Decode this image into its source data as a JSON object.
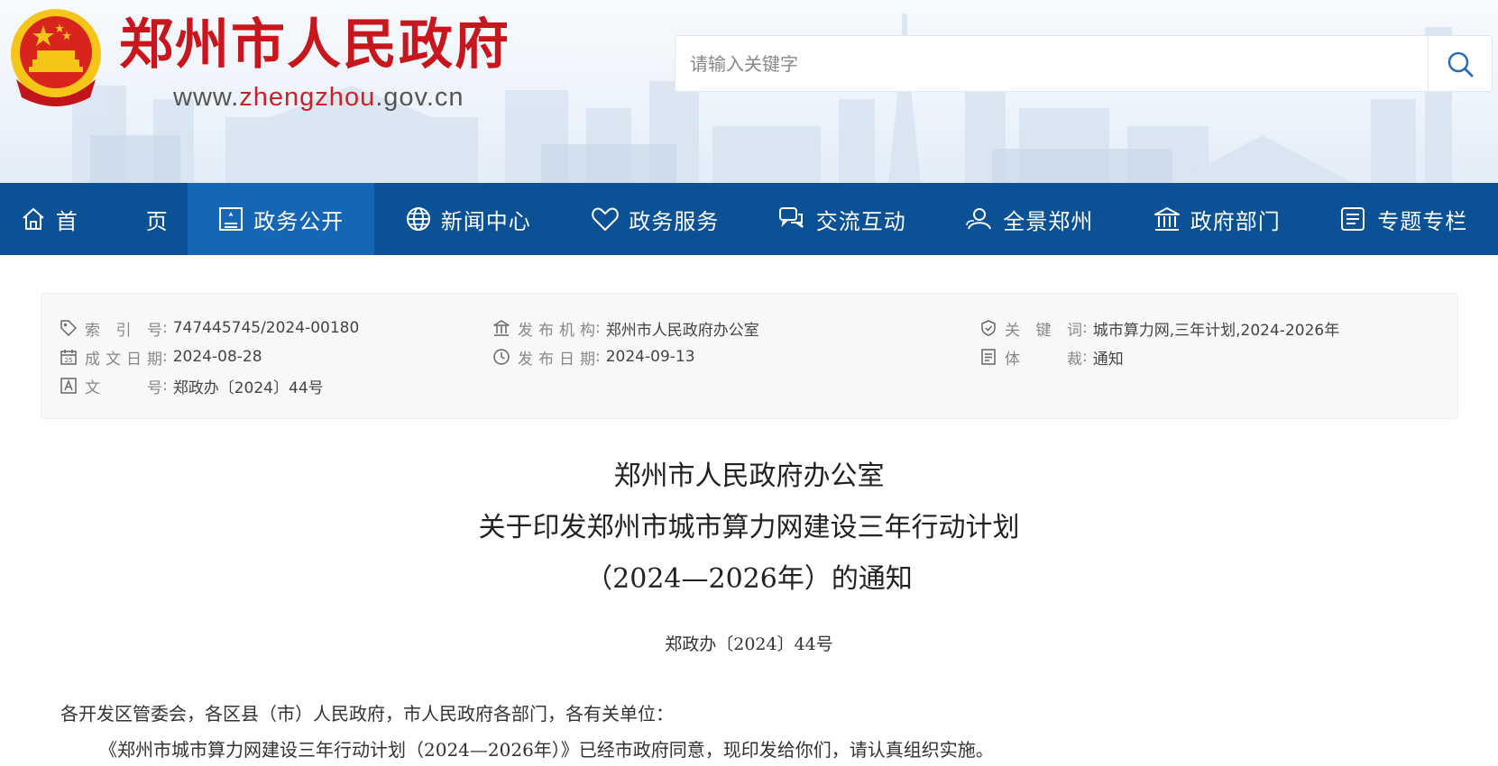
{
  "header": {
    "site_title": "郑州市人民政府",
    "url_prefix": "www.",
    "url_highlight": "zhengzhou",
    "url_suffix": ".gov.cn",
    "search": {
      "placeholder": "请输入关键字",
      "icon": "search-icon"
    }
  },
  "nav": {
    "items": [
      {
        "label": "首　页",
        "icon": "home-icon"
      },
      {
        "label": "政务公开",
        "icon": "document-icon",
        "active": true
      },
      {
        "label": "新闻中心",
        "icon": "globe-icon"
      },
      {
        "label": "政务服务",
        "icon": "heart-icon"
      },
      {
        "label": "交流互动",
        "icon": "chat-icon"
      },
      {
        "label": "全景郑州",
        "icon": "user-icon"
      },
      {
        "label": "政府部门",
        "icon": "building-icon"
      },
      {
        "label": "专题专栏",
        "icon": "list-icon"
      }
    ]
  },
  "meta": {
    "index_no": {
      "label": "索引号",
      "value": "747445745/2024-00180",
      "icon": "tag-icon"
    },
    "date_written": {
      "label": "成文日期",
      "value": "2024-08-28",
      "icon": "calendar-icon"
    },
    "doc_no": {
      "label": "文号",
      "value": "郑政办〔2024〕44号",
      "icon": "text-icon"
    },
    "publisher": {
      "label": "发布机构",
      "value": "郑州市人民政府办公室",
      "icon": "institution-icon"
    },
    "pub_date": {
      "label": "发布日期",
      "value": "2024-09-13",
      "icon": "clock-icon"
    },
    "keywords": {
      "label": "关键词",
      "value": "城市算力网,三年计划,2024-2026年",
      "icon": "shield-icon"
    },
    "genre": {
      "label": "体裁",
      "value": "通知",
      "icon": "file-icon"
    }
  },
  "article": {
    "title_line1": "郑州市人民政府办公室",
    "title_line2": "关于印发郑州市城市算力网建设三年行动计划",
    "title_line3": "（2024—2026年）的通知",
    "doc_number": "郑政办〔2024〕44号",
    "salutation": "各开发区管委会，各区县（市）人民政府，市人民政府各部门，各有关单位：",
    "para1": "《郑州市城市算力网建设三年行动计划（2024—2026年）》已经市政府同意，现印发给你们，请认真组织实施。"
  },
  "colors": {
    "brand_red": "#c8161d",
    "nav_blue": "#0a5196",
    "nav_active": "#1566b4",
    "gold": "#f5c518"
  }
}
